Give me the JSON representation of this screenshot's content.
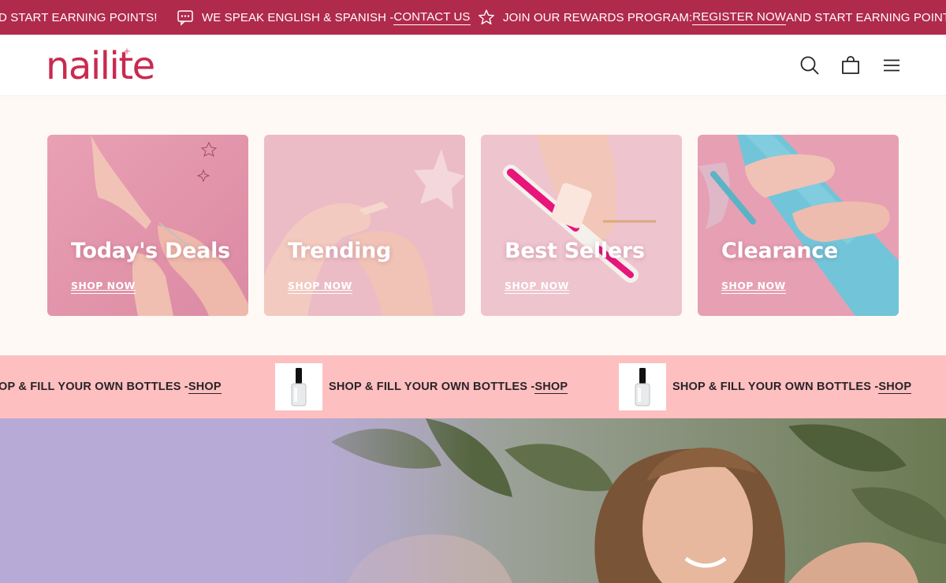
{
  "announcement": {
    "items": [
      {
        "text": "D START EARNING POINTS!",
        "link": "",
        "icon": ""
      },
      {
        "text": "WE SPEAK ENGLISH & SPANISH - ",
        "link": "CONTACT US",
        "icon": "chat-icon"
      },
      {
        "text": "JOIN OUR REWARDS PROGRAM: ",
        "link": "REGISTER NOW",
        "after": " AND START EARNING POINTS!",
        "icon": "star-icon"
      }
    ]
  },
  "header": {
    "logo": "nailite",
    "icons": [
      "search-icon",
      "cart-icon",
      "menu-icon"
    ]
  },
  "categories": [
    {
      "title": "Today's Deals",
      "cta": "SHOP NOW"
    },
    {
      "title": "Trending",
      "cta": "SHOP NOW"
    },
    {
      "title": "Best Sellers",
      "cta": "SHOP NOW"
    },
    {
      "title": "Clearance",
      "cta": "SHOP NOW"
    }
  ],
  "marquee": {
    "items": [
      {
        "text": "OP & FILL YOUR OWN BOTTLES - ",
        "link": "SHOP"
      },
      {
        "text": "SHOP & FILL YOUR OWN BOTTLES - ",
        "link": "SHOP"
      },
      {
        "text": "SHOP & FILL YOUR OWN BOTTLES - ",
        "link": "SHOP"
      }
    ]
  },
  "colors": {
    "announce_bg": "#b02a4c",
    "brand": "#c92a4f",
    "cats_bg": "#fff9f6",
    "marquee_bg": "#fdbfc0"
  }
}
